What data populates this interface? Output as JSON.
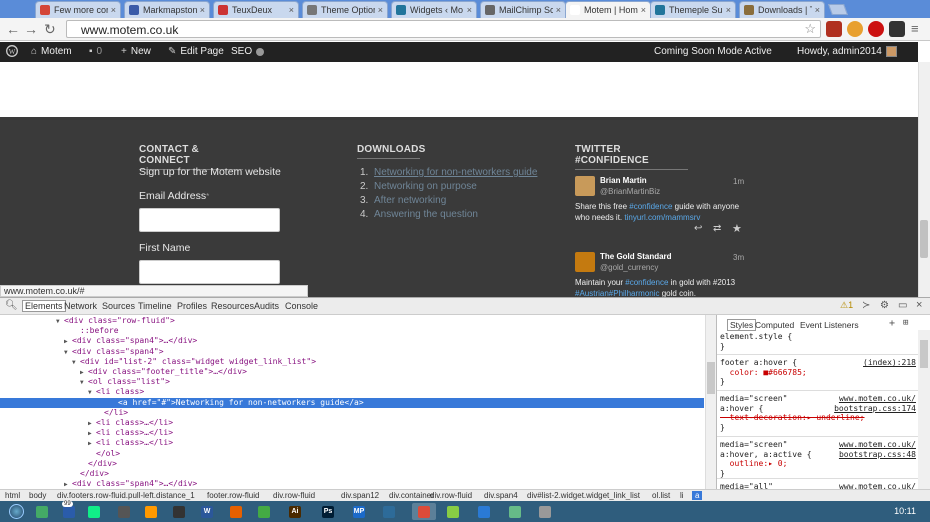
{
  "browser": {
    "tabs": [
      {
        "title": "Few more cor",
        "color": "#d44638"
      },
      {
        "title": "Markmapston",
        "color": "#3b5ba8"
      },
      {
        "title": "TeuxDeux",
        "color": "#cc3333"
      },
      {
        "title": "Theme Option",
        "color": "#777777"
      },
      {
        "title": "Widgets ‹ Mo",
        "color": "#21759b"
      },
      {
        "title": "MailChimp Sc",
        "color": "#666666"
      },
      {
        "title": "Motem | Hom",
        "color": "#ffffff"
      },
      {
        "title": "Themeple Sup",
        "color": "#21759b"
      },
      {
        "title": "Downloads | T",
        "color": "#8a6d3b"
      }
    ],
    "url": "www.motem.co.uk",
    "tab_close": "×"
  },
  "adminbar": {
    "site": "Motem",
    "comments": "0",
    "new": "New",
    "edit": "Edit Page",
    "seo": "SEO",
    "coming_soon": "Coming Soon Mode Active",
    "howdy": "Howdy, admin2014"
  },
  "footer": {
    "contact": {
      "heading": "CONTACT & CONNECT",
      "signup": "Sign up for the Motem website",
      "email_label": "Email Address",
      "required_mark": "*",
      "first_name_label": "First Name"
    },
    "downloads": {
      "heading": "DOWNLOADS",
      "items": [
        {
          "num": "1.",
          "label": "Networking for non-networkers guide"
        },
        {
          "num": "2.",
          "label": "Networking on purpose"
        },
        {
          "num": "3.",
          "label": "After networking"
        },
        {
          "num": "4.",
          "label": "Answering the question"
        }
      ]
    },
    "twitter": {
      "heading": "TWITTER #CONFIDENCE",
      "tweets": [
        {
          "name": "Brian Martin",
          "handle": "@BrianMartinBiz",
          "time": "1m",
          "text_1": "Share this free ",
          "hashtag_1": "#confidence",
          "text_2": " guide with anyone who needs it. ",
          "link": "tinyurl.com/mammsrv"
        },
        {
          "name": "The Gold Standard",
          "handle": "@gold_currency",
          "time": "3m",
          "text_1": "Maintain your ",
          "hashtag_1": "#confidence",
          "text_2": " in gold with #2013 ",
          "hashtag_2": "#Austrian",
          "hashtag_3": "#Philharmonic",
          "text_3": " gold coin."
        }
      ]
    }
  },
  "status_url": "www.motem.co.uk/#",
  "devtools": {
    "tabs": [
      "Elements",
      "Network",
      "Sources",
      "Timeline",
      "Profiles",
      "Resources",
      "Audits",
      "Console"
    ],
    "warn_count": "1",
    "dom": [
      {
        "indent": 64,
        "arrow": "▼",
        "html": "<div class=\"row-fluid\">"
      },
      {
        "indent": 80,
        "arrow": "",
        "html": "::before"
      },
      {
        "indent": 72,
        "arrow": "▶",
        "html": "<div class=\"span4\">…</div>"
      },
      {
        "indent": 72,
        "arrow": "▼",
        "html": "<div class=\"span4\">"
      },
      {
        "indent": 80,
        "arrow": "▼",
        "html": "<div id=\"list-2\" class=\"widget widget_link_list\">"
      },
      {
        "indent": 88,
        "arrow": "▶",
        "html": "<div class=\"footer_title\">…</div>"
      },
      {
        "indent": 88,
        "arrow": "▼",
        "html": "<ol class=\"list\">"
      },
      {
        "indent": 96,
        "arrow": "▼",
        "html": "<li class>"
      },
      {
        "indent": 110,
        "arrow": "",
        "html": "<a href=\"#\">Networking for non-networkers guide</a>"
      },
      {
        "indent": 104,
        "arrow": "",
        "html": "</li>"
      },
      {
        "indent": 96,
        "arrow": "▶",
        "html": "<li class>…</li>"
      },
      {
        "indent": 96,
        "arrow": "▶",
        "html": "<li class>…</li>"
      },
      {
        "indent": 96,
        "arrow": "▶",
        "html": "<li class>…</li>"
      },
      {
        "indent": 96,
        "arrow": "",
        "html": "</ol>"
      },
      {
        "indent": 88,
        "arrow": "",
        "html": "</div>"
      },
      {
        "indent": 80,
        "arrow": "",
        "html": "</div>"
      },
      {
        "indent": 72,
        "arrow": "▶",
        "html": "<div class=\"span4\">…</div>"
      }
    ],
    "styles_tabs": [
      "Styles",
      "Computed",
      "Event Listeners"
    ],
    "rules": [
      {
        "lines": [
          "element.style {",
          "}"
        ]
      },
      {
        "lines": [
          "footer a:hover {",
          "  color: ■#666785;",
          "}"
        ],
        "src": "(index):218"
      },
      {
        "lines": [
          "media=\"screen\"",
          "a:hover {",
          "  text-decoration:▸ underline;",
          "}"
        ],
        "src1": "www.motem.co.uk/",
        "src2": "bootstrap.css:174"
      },
      {
        "lines": [
          "media=\"screen\"",
          "a:hover, a:active {",
          "  outline:▸ 0;",
          "}"
        ],
        "src1": "www.motem.co.uk/",
        "src2": "bootstrap.css:48"
      },
      {
        "lines": [
          "media=\"all\"",
          "a:hover {"
        ],
        "src1": "www.motem.co.uk/",
        "src2": "style.css:643"
      }
    ],
    "breadcrumbs": [
      "html",
      "body",
      "div.footers.row-fluid.pull-left.distance_1",
      "footer.row-fluid",
      "div.row-fluid",
      "div.span12",
      "div.container",
      "div.row-fluid",
      "div.span4",
      "div#list-2.widget.widget_link_list",
      "ol.list",
      "li",
      "a"
    ]
  },
  "taskbar": {
    "time": "10:11",
    "badge": "99"
  }
}
